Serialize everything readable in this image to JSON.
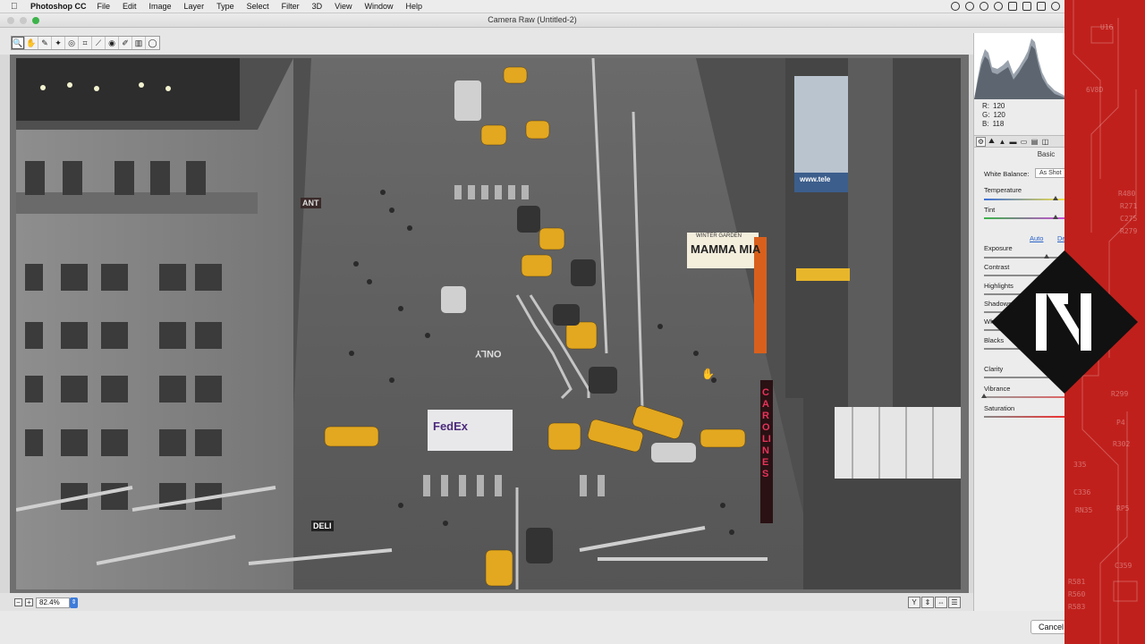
{
  "menubar": {
    "app_name": "Photoshop CC",
    "items": [
      "File",
      "Edit",
      "Image",
      "Layer",
      "Type",
      "Select",
      "Filter",
      "3D",
      "View",
      "Window",
      "Help"
    ]
  },
  "window": {
    "title": "Camera Raw (Untitled-2)"
  },
  "toolbar": {
    "tools": [
      "zoom-tool",
      "hand-tool",
      "white-balance-tool",
      "color-sampler-tool",
      "target-adjustment-tool",
      "crop-tool",
      "straighten-tool",
      "red-eye-tool",
      "adjustment-brush-tool",
      "graduated-filter-tool",
      "radial-filter-tool"
    ],
    "tool_glyphs": [
      "🔍",
      "✋",
      "✎",
      "✦",
      "◎",
      "⌗",
      "⟋",
      "◉",
      "✐",
      "▥",
      "◯"
    ]
  },
  "bottom": {
    "zoom_value": "82.4%",
    "zoom_minus": "−",
    "zoom_plus": "+",
    "view_glyphs": [
      "Y",
      "⇕",
      "⇔",
      "☰"
    ]
  },
  "footer": {
    "cancel_label": "Cancel"
  },
  "panel": {
    "rgb": {
      "r_label": "R:",
      "r_value": "120",
      "g_label": "G:",
      "g_value": "120",
      "b_label": "B:",
      "b_value": "118"
    },
    "tab_glyphs": [
      "⚙",
      "⛰",
      "▲",
      "▬",
      "▭",
      "▤",
      "◫"
    ],
    "section_title": "Basic",
    "white_balance_label": "White Balance:",
    "white_balance_value": "As Shot",
    "sliders": {
      "temperature": "Temperature",
      "tint": "Tint",
      "exposure": "Exposure",
      "contrast": "Contrast",
      "highlights": "Highlights",
      "shadows": "Shadows",
      "whites": "Whites",
      "blacks": "Blacks",
      "clarity": "Clarity",
      "vibrance": "Vibrance",
      "saturation": "Saturation"
    },
    "auto_label": "Auto",
    "default_label": "Default"
  },
  "photo_signage": {
    "mammamia": "MAMMA MIA",
    "winter_garden": "WINTER GARDEN",
    "carolines": "CAROLINES",
    "fedex": "FedEx",
    "only": "ONLY",
    "deli": "DELI",
    "ant": "ANT",
    "telecom": "www.tele"
  },
  "overlay": {
    "circuit_labels": [
      "U16",
      "6V8D",
      "R480",
      "R271",
      "C275",
      "R279",
      "R299",
      "R302",
      "335",
      "C336",
      "RN35",
      "RP5",
      "C359",
      "R581",
      "R560",
      "R583",
      "P4"
    ]
  }
}
